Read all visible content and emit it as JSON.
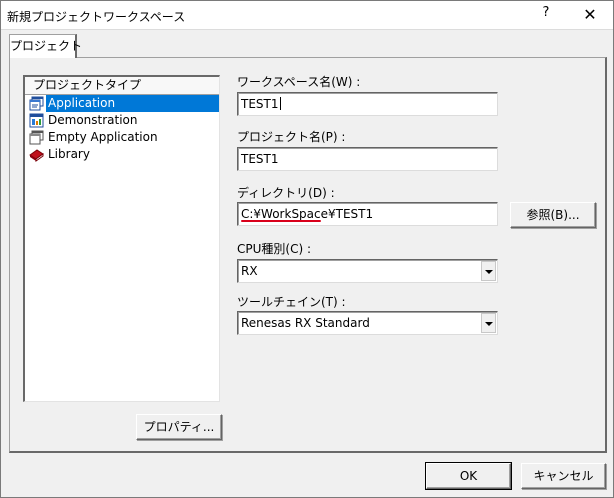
{
  "window": {
    "title": "新規プロジェクトワークスペース",
    "help": "?",
    "close": "✕"
  },
  "tab": {
    "label": "プロジェクト"
  },
  "project_type": {
    "header": "プロジェクトタイプ",
    "items": [
      {
        "label": "Application",
        "icon": "application-icon",
        "selected": true
      },
      {
        "label": "Demonstration",
        "icon": "demonstration-icon",
        "selected": false
      },
      {
        "label": "Empty Application",
        "icon": "empty-application-icon",
        "selected": false
      },
      {
        "label": "Library",
        "icon": "library-icon",
        "selected": false
      }
    ]
  },
  "workspace_name": {
    "label": "ワークスペース名(W) :",
    "value": "TEST1"
  },
  "project_name": {
    "label": "プロジェクト名(P) :",
    "value": "TEST1"
  },
  "directory": {
    "label": "ディレクトリ(D) :",
    "value": "C:¥WorkSpace¥TEST1",
    "browse_label": "参照(B)..."
  },
  "cpu_type": {
    "label": "CPU種別(C) :",
    "value": "RX"
  },
  "toolchain": {
    "label": "ツールチェイン(T) :",
    "value": "Renesas RX Standard"
  },
  "properties_button": "プロパティ...",
  "ok_button": "OK",
  "cancel_button": "キャンセル",
  "colors": {
    "selection": "#0078d7",
    "annotation_underline": "#d9001b",
    "dialog_background": "#f0f0f0"
  }
}
